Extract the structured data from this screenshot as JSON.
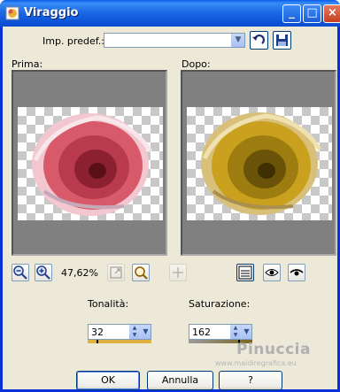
{
  "window": {
    "title": "Viraggio"
  },
  "titlebar_buttons": {
    "minimize": "_",
    "maximize": "□",
    "close": "×"
  },
  "presets": {
    "label": "Imp. predef.:",
    "value": ""
  },
  "preview": {
    "before_label": "Prima:",
    "after_label": "Dopo:"
  },
  "toolbar": {
    "zoom": "47,62%"
  },
  "hue": {
    "label": "Tonalità:",
    "value": "32"
  },
  "saturation": {
    "label": "Saturazione:",
    "value": "162"
  },
  "buttons": {
    "ok": "OK",
    "cancel": "Annulla",
    "help": "?"
  },
  "watermark": {
    "name": "Pinuccia",
    "url": "www.maidiregrafica.eu"
  },
  "colors": {
    "hue_bar": "#e0b040",
    "saturation_bar": "#7a6520",
    "rose_before": "#d85a6a",
    "rose_after": "#c9a11e"
  }
}
